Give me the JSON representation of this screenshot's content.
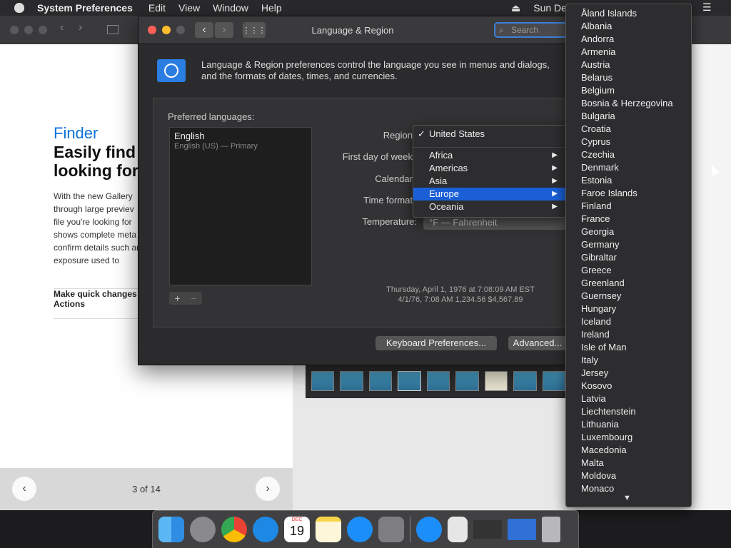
{
  "menubar": {
    "app": "System Preferences",
    "items": [
      "Edit",
      "View",
      "Window",
      "Help"
    ],
    "clock": "Sun De"
  },
  "background": {
    "article_kicker": "Finder",
    "article_headline": "Easily find what you're looking for",
    "article_headline_visible": "Easily find v looking for",
    "article_body": "With the new Gallery through large previev file you're looking for shows complete meta confirm details such and exposure used to",
    "actions_label": "Make quick changes Actions",
    "pager_text": "3 of 14"
  },
  "window": {
    "title": "Language & Region",
    "search_placeholder": "Search",
    "description": "Language & Region preferences control the language you see in menus and dialogs, and the formats of dates, times, and currencies.",
    "preferred_languages_label": "Preferred languages:",
    "language": {
      "name": "English",
      "detail": "English (US) — Primary"
    },
    "add": "+",
    "remove": "−",
    "fields": {
      "region": "Region",
      "first_day": "First day of week",
      "calendar": "Calendar",
      "time_format": "Time format",
      "temperature": "Temperature:",
      "temperature_value": "°F — Fahrenheit"
    },
    "sample_line1": "Thursday, April 1, 1976 at 7:08:09 AM EST",
    "sample_line2": "4/1/76, 7:08 AM     1,234.56     $4,567.89",
    "keyboard_button": "Keyboard Preferences...",
    "advanced_button": "Advanced..."
  },
  "region_menu": {
    "checked": "United States",
    "check_mark": "✓",
    "items": [
      "Africa",
      "Americas",
      "Asia",
      "Europe",
      "Oceania"
    ],
    "selected": "Europe"
  },
  "country_menu": {
    "items": [
      "Åland Islands",
      "Albania",
      "Andorra",
      "Armenia",
      "Austria",
      "Belarus",
      "Belgium",
      "Bosnia & Herzegovina",
      "Bulgaria",
      "Croatia",
      "Cyprus",
      "Czechia",
      "Denmark",
      "Estonia",
      "Faroe Islands",
      "Finland",
      "France",
      "Georgia",
      "Germany",
      "Gibraltar",
      "Greece",
      "Greenland",
      "Guernsey",
      "Hungary",
      "Iceland",
      "Ireland",
      "Isle of Man",
      "Italy",
      "Jersey",
      "Kosovo",
      "Latvia",
      "Liechtenstein",
      "Lithuania",
      "Luxembourg",
      "Macedonia",
      "Malta",
      "Moldova",
      "Monaco"
    ]
  },
  "dock": {
    "icons": [
      "finder-icon",
      "launchpad-icon",
      "chrome-icon",
      "safari-icon",
      "calendar-icon",
      "notes-icon",
      "app-store-icon",
      "system-preferences-icon",
      "app-store-download-icon",
      "preview-icon",
      "window-icon",
      "id-card-icon",
      "trash-icon"
    ],
    "calendar_month": "DEC",
    "calendar_day": "19"
  }
}
